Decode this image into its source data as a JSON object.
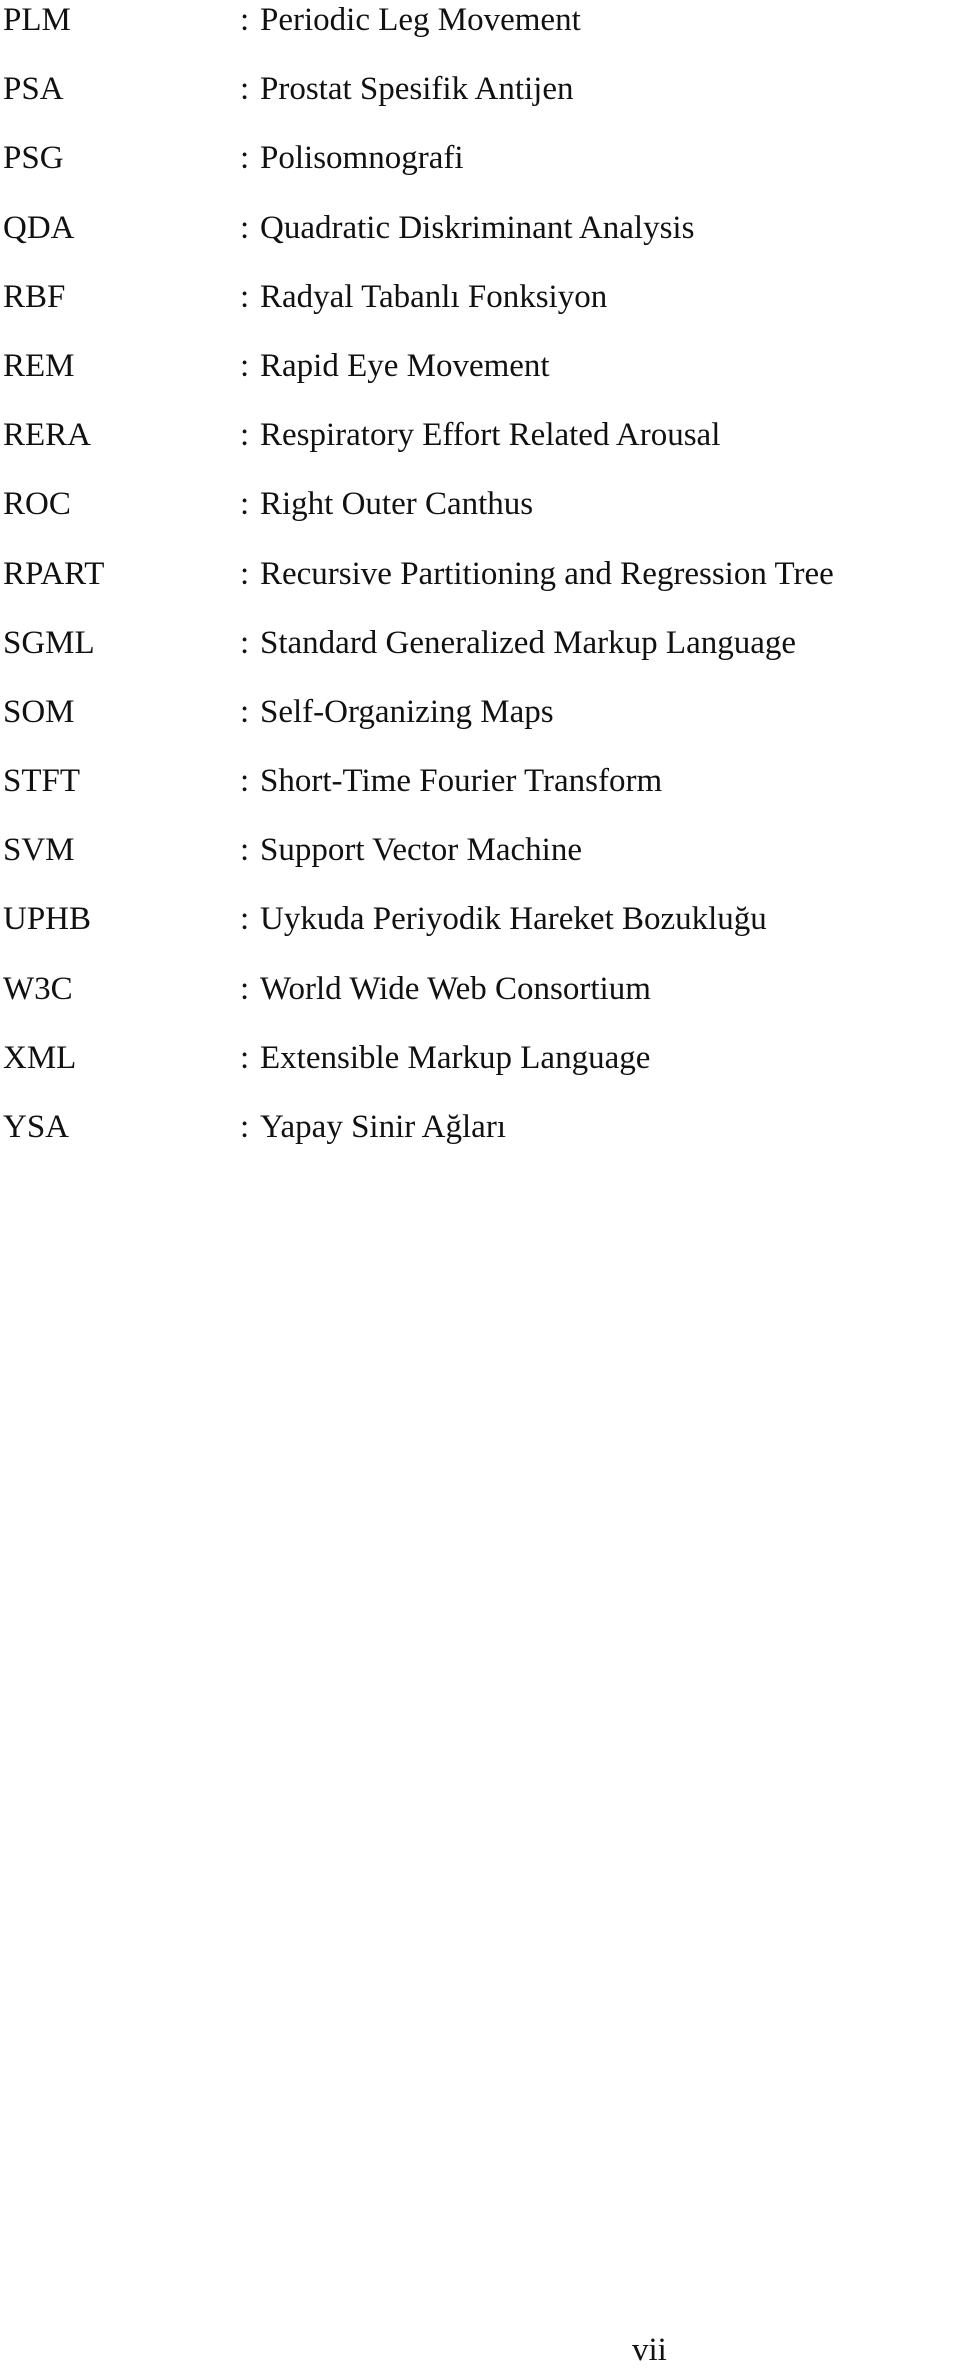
{
  "abbreviations": [
    {
      "term": "PLM",
      "separator": ":",
      "definition": "Periodic Leg Movement"
    },
    {
      "term": "PSA",
      "separator": ":",
      "definition": "Prostat Spesifik Antijen"
    },
    {
      "term": "PSG",
      "separator": ":",
      "definition": "Polisomnografi"
    },
    {
      "term": "QDA",
      "separator": ":",
      "definition": "Quadratic Diskriminant Analysis"
    },
    {
      "term": "RBF",
      "separator": ":",
      "definition": "Radyal Tabanlı Fonksiyon"
    },
    {
      "term": "REM",
      "separator": ":",
      "definition": "Rapid Eye Movement"
    },
    {
      "term": "RERA",
      "separator": ":",
      "definition": "Respiratory Effort Related Arousal"
    },
    {
      "term": "ROC",
      "separator": ":",
      "definition": "Right Outer Canthus"
    },
    {
      "term": "RPART",
      "separator": ":",
      "definition": "Recursive Partitioning and Regression Tree"
    },
    {
      "term": "SGML",
      "separator": ":",
      "definition": "Standard Generalized Markup Language"
    },
    {
      "term": "SOM",
      "separator": ":",
      "definition": "Self-Organizing Maps"
    },
    {
      "term": "STFT",
      "separator": ":",
      "definition": "Short-Time Fourier Transform"
    },
    {
      "term": "SVM",
      "separator": ":",
      "definition": "Support Vector Machine"
    },
    {
      "term": "UPHB",
      "separator": ":",
      "definition": "Uykuda Periyodik Hareket Bozukluğu"
    },
    {
      "term": "W3C",
      "separator": ":",
      "definition": "World Wide Web Consortium"
    },
    {
      "term": "XML",
      "separator": ":",
      "definition": "Extensible Markup Language"
    },
    {
      "term": "YSA",
      "separator": ":",
      "definition": "Yapay Sinir Ağları"
    }
  ],
  "page": {
    "number": "vii"
  }
}
